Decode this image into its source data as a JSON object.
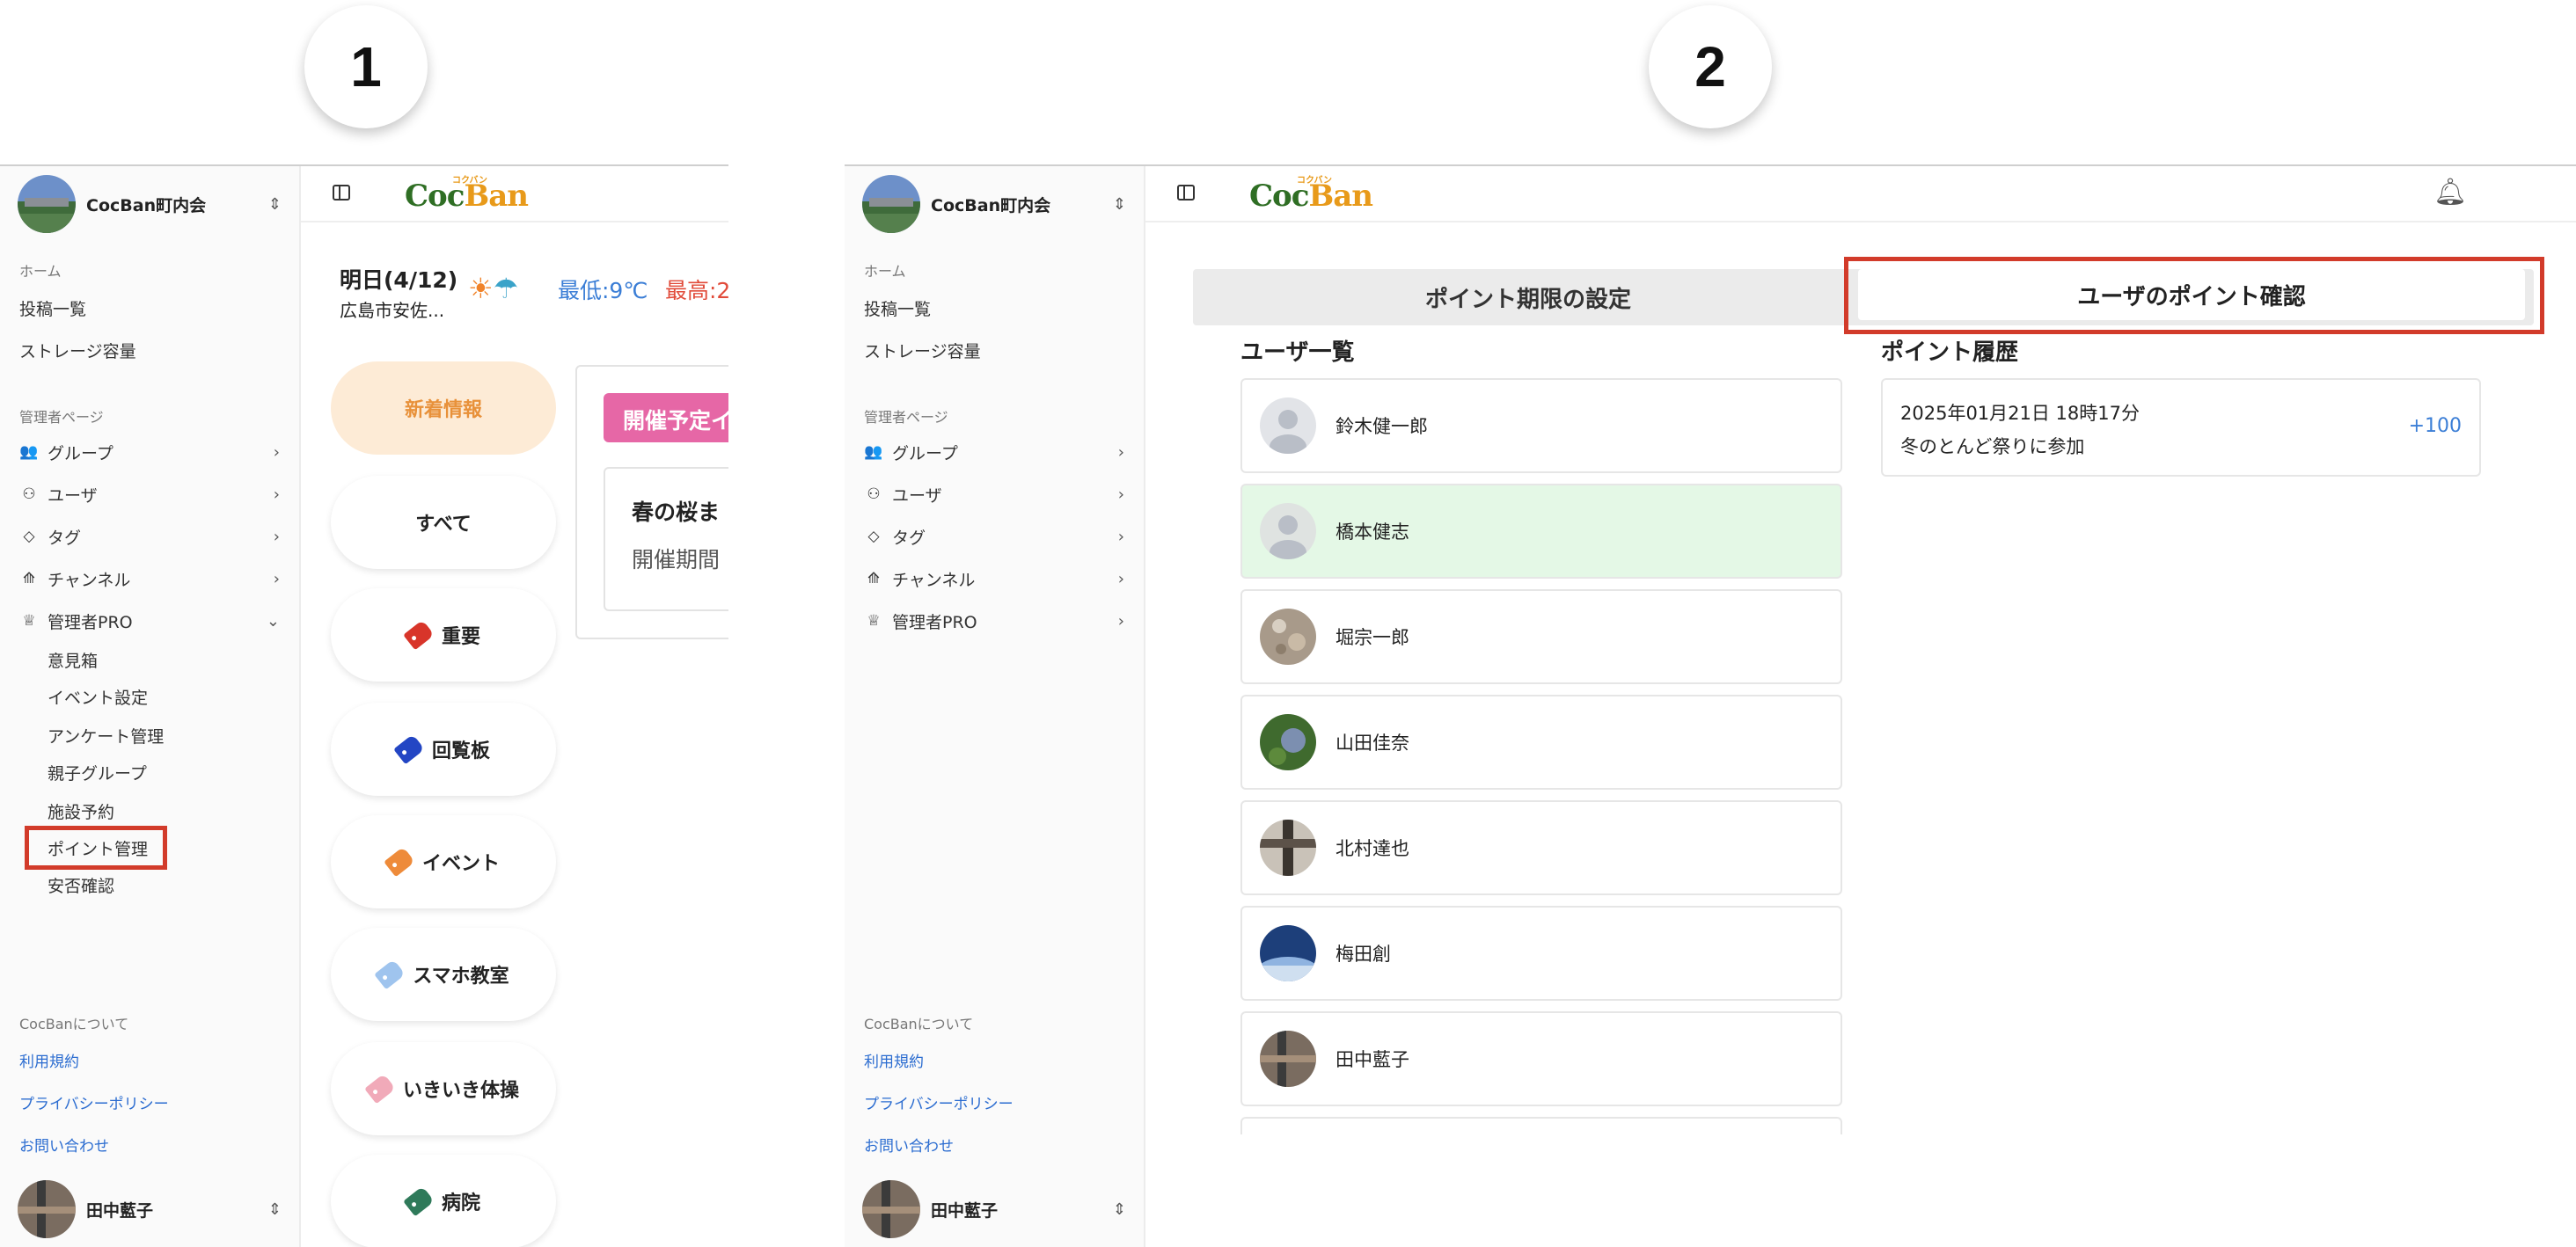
{
  "steps": [
    "1",
    "2"
  ],
  "org_name": "CocBan町内会",
  "sidebar": {
    "home_label": "ホーム",
    "posts": "投稿一覧",
    "storage": "ストレージ容量",
    "admin_label": "管理者ページ",
    "items": [
      {
        "label": "グループ",
        "icon": "users-icon"
      },
      {
        "label": "ユーザ",
        "icon": "user-icon"
      },
      {
        "label": "タグ",
        "icon": "tag-icon"
      },
      {
        "label": "チャンネル",
        "icon": "channel-icon"
      },
      {
        "label": "管理者PRO",
        "icon": "badge-icon"
      }
    ],
    "pro_sub": [
      "意見箱",
      "イベント設定",
      "アンケート管理",
      "親子グループ",
      "施設予約",
      "ポイント管理",
      "安否確認"
    ],
    "about_label": "CocBanについて",
    "links": [
      "利用規約",
      "プライバシーポリシー",
      "お問い合わせ"
    ],
    "user_name": "田中藍子"
  },
  "logo": {
    "text_a": "Coc",
    "text_b": "Ban",
    "ruby": "コクバン"
  },
  "weather": {
    "date": "明日(4/12)",
    "place": "広島市安佐...",
    "min": "最低:9℃",
    "max": "最高:2"
  },
  "filters": [
    "新着情報",
    "すべて",
    "重要",
    "回覧板",
    "イベント",
    "スマホ教室",
    "いきいき体操",
    "病院"
  ],
  "event_panel": {
    "badge": "開催予定イ",
    "title": "春の桜ま",
    "subtitle": "開催期間"
  },
  "point_tabs": {
    "settings": "ポイント期限の設定",
    "confirm": "ユーザのポイント確認"
  },
  "user_list_title": "ユーザ一覧",
  "users": [
    "鈴木健一郎",
    "橋本健志",
    "堀宗一郎",
    "山田佳奈",
    "北村達也",
    "梅田創",
    "田中藍子"
  ],
  "history_title": "ポイント履歴",
  "history": [
    {
      "datetime": "2025年01月21日 18時17分",
      "desc": "冬のとんど祭りに参加",
      "points": "+100"
    }
  ],
  "colors": {
    "accent_red": "#d23b2a",
    "selected_row": "#e4f8e6",
    "new_info_bg": "#fdebd6",
    "new_info_text": "#e8913a",
    "event_badge": "#e667a6",
    "link": "#2b6cd0"
  }
}
